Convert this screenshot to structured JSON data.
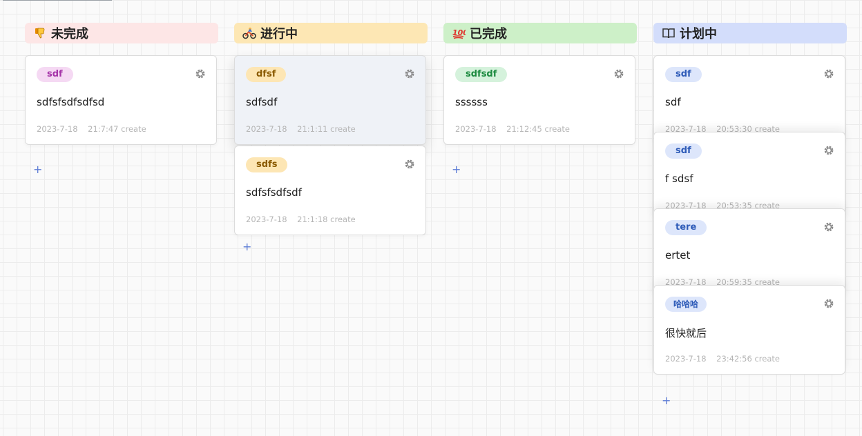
{
  "columns": [
    {
      "title": "未完成",
      "icon": "thumbs-down-icon",
      "header_color": "#fde6e6",
      "cards": [
        {
          "tag": "sdf",
          "text": "sdfsfsdfsdfsd",
          "date": "2023-7-18",
          "time": "21:7:47 create"
        }
      ],
      "add_label": "+"
    },
    {
      "title": "进行中",
      "icon": "cyclist-icon",
      "header_color": "#fde7b4",
      "cards": [
        {
          "tag": "dfsf",
          "text": "sdfsdf",
          "date": "2023-7-18",
          "time": "21:1:11 create"
        },
        {
          "tag": "sdfs",
          "text": "sdfsfsdfsdf",
          "date": "2023-7-18",
          "time": "21:1:18 create"
        }
      ],
      "add_label": "+"
    },
    {
      "title": "已完成",
      "icon": "hundred-points-icon",
      "header_color": "#cdf0c8",
      "cards": [
        {
          "tag": "sdfsdf",
          "text": "ssssss",
          "date": "2023-7-18",
          "time": "21:12:45 create"
        }
      ],
      "add_label": "+"
    },
    {
      "title": "计划中",
      "icon": "open-book-icon",
      "header_color": "#d3ddfb",
      "cards": [
        {
          "tag": "sdf",
          "text": "sdf",
          "date": "2023-7-18",
          "time": "20:53:30 create"
        },
        {
          "tag": "sdf",
          "text": "f sdsf",
          "date": "2023-7-18",
          "time": "20:53:35 create"
        },
        {
          "tag": "tere",
          "text": "ertet",
          "date": "2023-7-18",
          "time": "20:59:35 create"
        },
        {
          "tag": "哈哈哈",
          "text": "很快就后",
          "date": "2023-7-18",
          "time": "23:42:56 create"
        }
      ],
      "add_label": "+"
    }
  ],
  "tag_colors": {
    "pink": {
      "bg": "#f5d9f3",
      "fg": "#a533a8"
    },
    "yellow": {
      "bg": "#fde6b4",
      "fg": "#8a5a00"
    },
    "green": {
      "bg": "#d5f2dc",
      "fg": "#1b8a3f"
    },
    "blue": {
      "bg": "#dde6fb",
      "fg": "#2e5bb8"
    }
  },
  "icons": {
    "settings": "gear-icon",
    "add": "plus-icon"
  }
}
